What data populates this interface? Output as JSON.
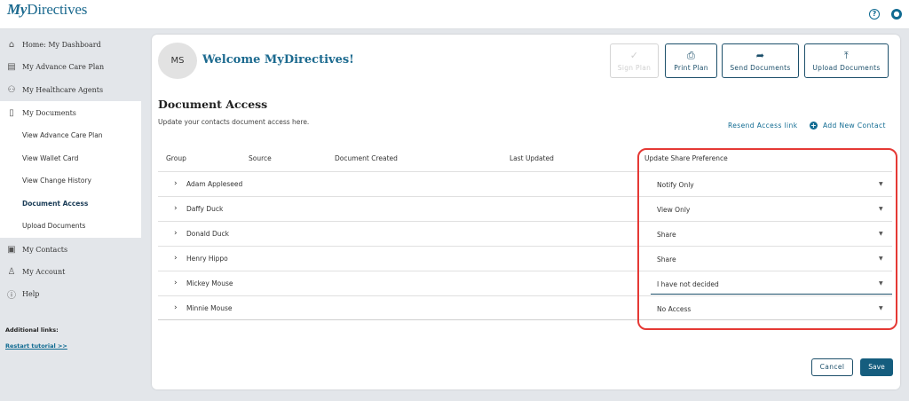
{
  "header": {
    "logo_prefix": "My",
    "logo_main": "Directives",
    "help_icon": "?",
    "account_icon": "user-icon"
  },
  "sidebar": {
    "nav": [
      {
        "label": "Home: My Dashboard",
        "icon": "⌂"
      },
      {
        "label": "My Advance Care Plan",
        "icon": "▤"
      },
      {
        "label": "My Healthcare Agents",
        "icon": "⚇"
      },
      {
        "label": "My Documents",
        "icon": "▯"
      },
      {
        "label": "My Contacts",
        "icon": "▣"
      },
      {
        "label": "My Account",
        "icon": "♙"
      },
      {
        "label": "Help",
        "icon": "ⓘ"
      }
    ],
    "documents_sub": [
      "View Advance Care Plan",
      "View Wallet Card",
      "View Change History",
      "Document Access",
      "Upload Documents"
    ],
    "additional_links_label": "Additional links:",
    "restart_tutorial": "Restart tutorial >>"
  },
  "main": {
    "avatar_initials": "MS",
    "welcome": "Welcome MyDirectives!",
    "actions": [
      {
        "label": "Sign Plan",
        "icon": "✓"
      },
      {
        "label": "Print Plan",
        "icon": "⎙"
      },
      {
        "label": "Send Documents",
        "icon": "➦"
      },
      {
        "label": "Upload Documents",
        "icon": "⤒"
      }
    ],
    "title": "Document Access",
    "subtitle": "Update your contacts document access here.",
    "resend_link": "Resend Access link",
    "add_contact": "Add New Contact",
    "columns": [
      "Group",
      "Source",
      "Document Created",
      "Last Updated",
      "Update Share Preference"
    ],
    "rows": [
      {
        "name": "Adam Appleseed",
        "preference": "Notify Only"
      },
      {
        "name": "Daffy Duck",
        "preference": "View Only"
      },
      {
        "name": "Donald Duck",
        "preference": "Share"
      },
      {
        "name": "Henry Hippo",
        "preference": "Share"
      },
      {
        "name": "Mickey Mouse",
        "preference": "I have not decided"
      },
      {
        "name": "Minnie Mouse",
        "preference": "No Access"
      }
    ],
    "cancel": "Cancel",
    "save": "Save"
  },
  "colors": {
    "brand": "#1c6a8f",
    "primary_button": "#155d7e",
    "highlight": "#e53935"
  }
}
